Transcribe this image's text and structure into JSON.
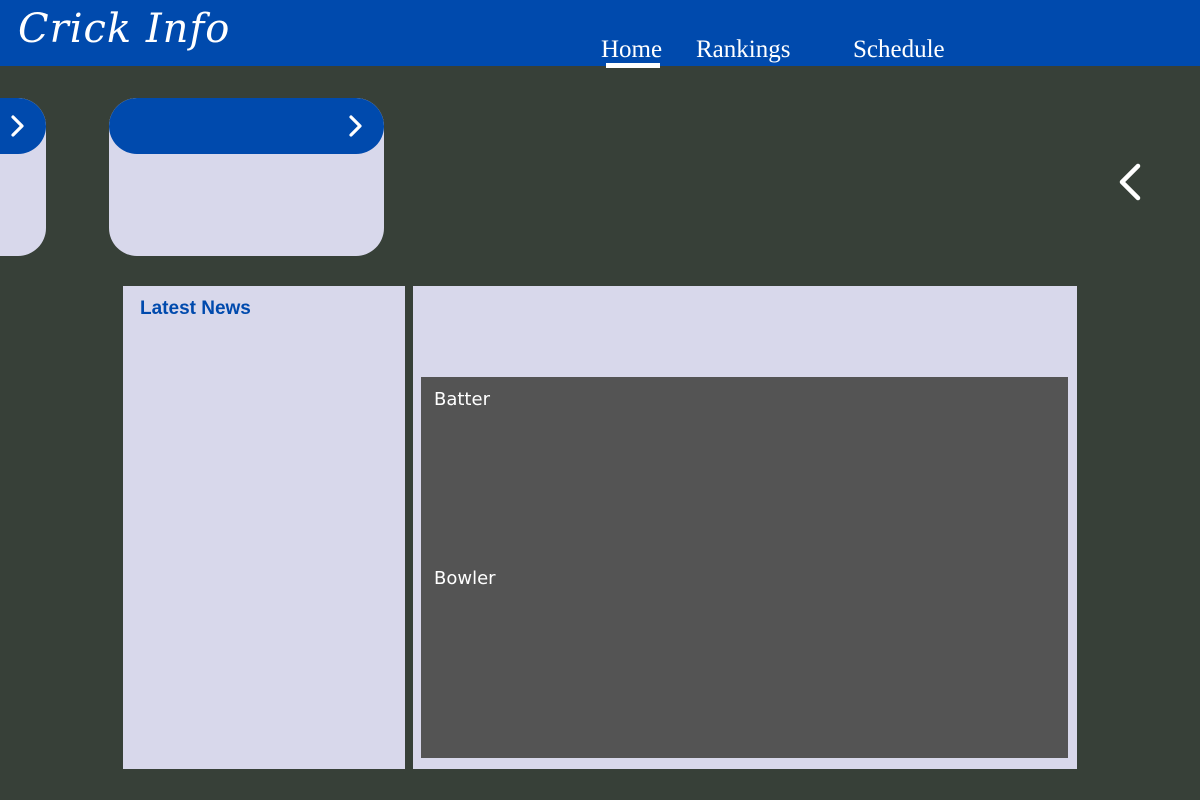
{
  "header": {
    "logo": "Crick Info",
    "nav": {
      "home": "Home",
      "rankings": "Rankings",
      "schedule": "Schedule"
    },
    "active_nav": "Home"
  },
  "icons": {
    "card_next": "chevron-right-icon",
    "carousel_prev": "chevron-left-icon"
  },
  "news": {
    "title": "Latest News"
  },
  "scorecard": {
    "batter_label": "Batter",
    "bowler_label": "Bowler"
  },
  "colors": {
    "brand": "#004aad",
    "background": "#374038",
    "panel": "#d8d8eb",
    "scorebox": "#545454"
  }
}
